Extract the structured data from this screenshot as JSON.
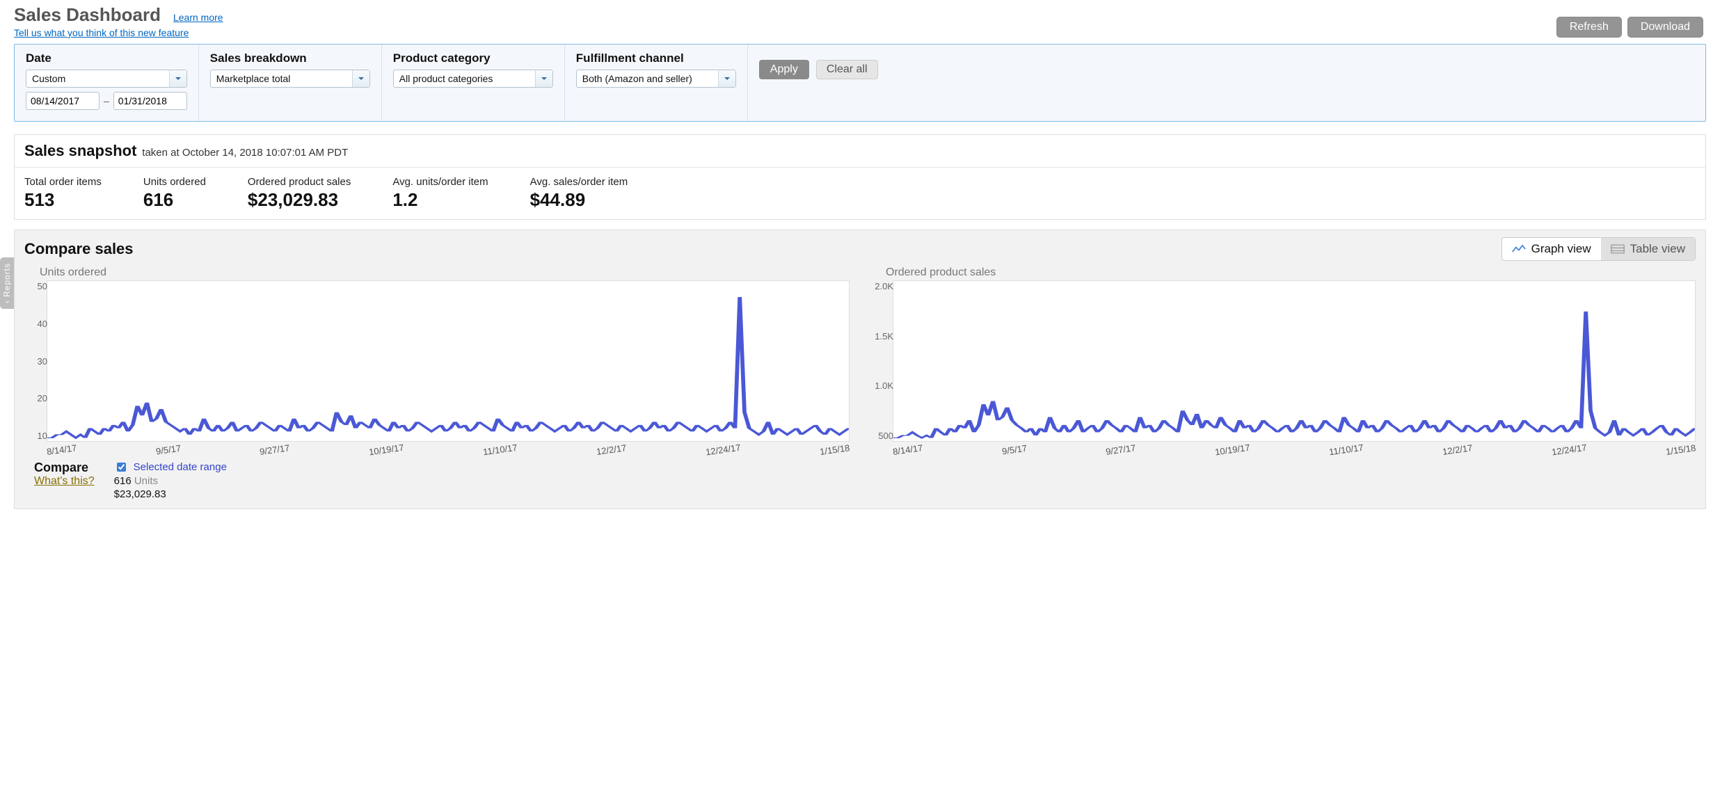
{
  "header": {
    "title": "Sales Dashboard",
    "learn_more": "Learn more",
    "feedback_link": "Tell us what you think of this new feature",
    "refresh": "Refresh",
    "download": "Download"
  },
  "filters": {
    "date": {
      "label": "Date",
      "preset": "Custom",
      "from": "08/14/2017",
      "to": "01/31/2018",
      "dash": "–"
    },
    "breakdown": {
      "label": "Sales breakdown",
      "value": "Marketplace total"
    },
    "category": {
      "label": "Product category",
      "value": "All product categories"
    },
    "channel": {
      "label": "Fulfillment channel",
      "value": "Both (Amazon and seller)"
    },
    "apply": "Apply",
    "clear": "Clear all"
  },
  "snapshot": {
    "title": "Sales snapshot",
    "taken_prefix": "taken at ",
    "taken_at": "October 14, 2018 10:07:01 AM PDT",
    "metrics": [
      {
        "label": "Total order items",
        "value": "513"
      },
      {
        "label": "Units ordered",
        "value": "616"
      },
      {
        "label": "Ordered product sales",
        "value": "$23,029.83"
      },
      {
        "label": "Avg. units/order item",
        "value": "1.2"
      },
      {
        "label": "Avg. sales/order item",
        "value": "$44.89"
      }
    ]
  },
  "compare": {
    "title": "Compare sales",
    "graph_view": "Graph view",
    "table_view": "Table view",
    "compare_label": "Compare",
    "whats_this": "What's this?",
    "legend_selected": "Selected date range",
    "legend_units_value": "616",
    "legend_units_label": "Units",
    "legend_sales": "$23,029.83"
  },
  "sidetab": "Reports",
  "chart_data": [
    {
      "type": "line",
      "title": "Units ordered",
      "xlabel": "",
      "ylabel": "",
      "ylim": [
        0,
        50
      ],
      "yticks": [
        "50",
        "40",
        "30",
        "20",
        "10"
      ],
      "x_ticks": [
        "8/14/17",
        "9/5/17",
        "9/27/17",
        "10/19/17",
        "11/10/17",
        "12/2/17",
        "12/24/17",
        "1/15/18"
      ],
      "series": [
        {
          "name": "Selected date range",
          "color": "#4a58d6",
          "values": [
            1,
            1,
            2,
            2,
            3,
            2,
            1,
            2,
            1,
            4,
            3,
            2,
            4,
            3,
            5,
            4,
            6,
            3,
            5,
            11,
            8,
            12,
            6,
            7,
            10,
            6,
            5,
            4,
            3,
            4,
            2,
            4,
            3,
            7,
            4,
            3,
            5,
            3,
            4,
            6,
            3,
            4,
            5,
            3,
            4,
            6,
            5,
            4,
            3,
            5,
            4,
            3,
            7,
            4,
            5,
            3,
            4,
            6,
            5,
            4,
            3,
            9,
            6,
            5,
            8,
            4,
            6,
            5,
            4,
            7,
            5,
            4,
            3,
            6,
            4,
            5,
            3,
            4,
            6,
            5,
            4,
            3,
            4,
            5,
            3,
            4,
            6,
            4,
            5,
            3,
            4,
            6,
            5,
            4,
            3,
            7,
            5,
            4,
            3,
            6,
            4,
            5,
            3,
            4,
            6,
            5,
            4,
            3,
            4,
            5,
            3,
            4,
            6,
            4,
            5,
            3,
            4,
            6,
            5,
            4,
            3,
            5,
            4,
            3,
            4,
            5,
            3,
            4,
            6,
            4,
            5,
            3,
            4,
            6,
            5,
            4,
            3,
            5,
            4,
            3,
            4,
            5,
            3,
            4,
            6,
            4,
            45,
            9,
            4,
            3,
            2,
            3,
            6,
            2,
            4,
            3,
            2,
            3,
            4,
            2,
            3,
            4,
            5,
            3,
            2,
            4,
            3,
            2,
            3,
            4
          ]
        }
      ]
    },
    {
      "type": "line",
      "title": "Ordered product sales",
      "xlabel": "",
      "ylabel": "",
      "ylim": [
        0,
        2000
      ],
      "yticks": [
        "2.0K",
        "1.5K",
        "1.0K",
        "500"
      ],
      "x_ticks": [
        "8/14/17",
        "9/5/17",
        "9/27/17",
        "10/19/17",
        "11/10/17",
        "12/2/17",
        "12/24/17",
        "1/15/18"
      ],
      "series": [
        {
          "name": "Selected date range",
          "color": "#4a58d6",
          "values": [
            40,
            40,
            70,
            70,
            110,
            70,
            40,
            70,
            40,
            160,
            110,
            70,
            160,
            110,
            200,
            160,
            260,
            110,
            200,
            460,
            320,
            500,
            260,
            300,
            420,
            260,
            200,
            160,
            110,
            160,
            70,
            160,
            110,
            300,
            160,
            110,
            200,
            110,
            160,
            260,
            110,
            160,
            200,
            110,
            160,
            260,
            200,
            160,
            110,
            200,
            160,
            110,
            300,
            160,
            200,
            110,
            160,
            260,
            200,
            160,
            110,
            380,
            260,
            200,
            340,
            160,
            260,
            200,
            160,
            300,
            200,
            160,
            110,
            260,
            160,
            200,
            110,
            160,
            260,
            200,
            160,
            110,
            160,
            200,
            110,
            160,
            260,
            160,
            200,
            110,
            160,
            260,
            200,
            160,
            110,
            300,
            200,
            160,
            110,
            260,
            160,
            200,
            110,
            160,
            260,
            200,
            160,
            110,
            160,
            200,
            110,
            160,
            260,
            160,
            200,
            110,
            160,
            260,
            200,
            160,
            110,
            200,
            160,
            110,
            160,
            200,
            110,
            160,
            260,
            160,
            200,
            110,
            160,
            260,
            200,
            160,
            110,
            200,
            160,
            110,
            160,
            200,
            110,
            160,
            260,
            160,
            1620,
            380,
            160,
            110,
            70,
            110,
            260,
            70,
            160,
            110,
            70,
            110,
            160,
            70,
            110,
            160,
            200,
            110,
            70,
            160,
            110,
            70,
            110,
            160
          ]
        }
      ]
    }
  ]
}
